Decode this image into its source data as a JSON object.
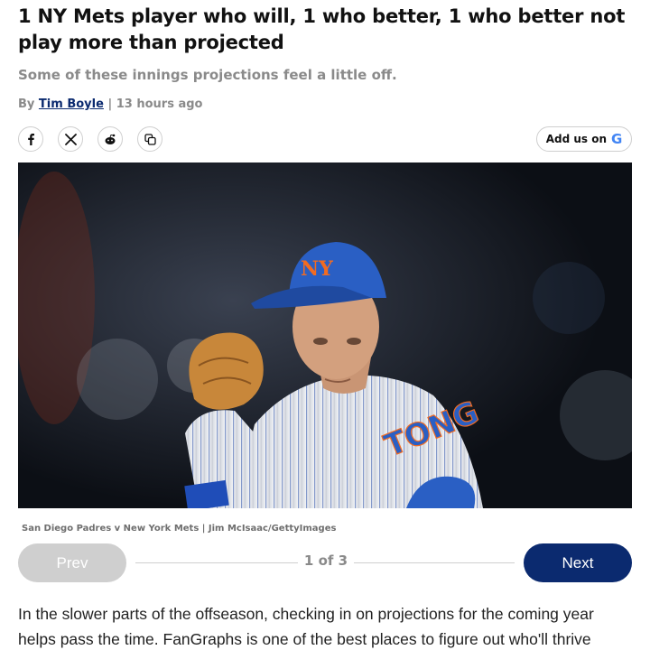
{
  "article": {
    "headline": "1 NY Mets player who will, 1 who better, 1 who better not play more than projected",
    "subhead": "Some of these innings projections feel a little off.",
    "byline": {
      "prefix": "By",
      "author": "Tim Boyle",
      "separator": "|",
      "time": "13 hours ago"
    }
  },
  "share": {
    "icons": [
      "facebook-icon",
      "x-icon",
      "reddit-icon",
      "copy-link-icon"
    ],
    "add_us_label": "Add us on",
    "google_letter": "G"
  },
  "hero_image": {
    "jersey_text": "TONG",
    "caption": "San Diego Padres v New York Mets | Jim McIsaac/GettyImages"
  },
  "gallery": {
    "prev_label": "Prev",
    "next_label": "Next",
    "counter": "1 of 3"
  },
  "body": {
    "paragraph": "In the slower parts of the offseason, checking in on projections for the coming year helps pass the time. FanGraphs is one of the best places to figure out who'll thrive"
  },
  "colors": {
    "accent_navy": "#0b2a6f",
    "muted_gray": "#8a8a8a",
    "mets_blue": "#2a5fc4",
    "mets_orange": "#f26b21"
  }
}
